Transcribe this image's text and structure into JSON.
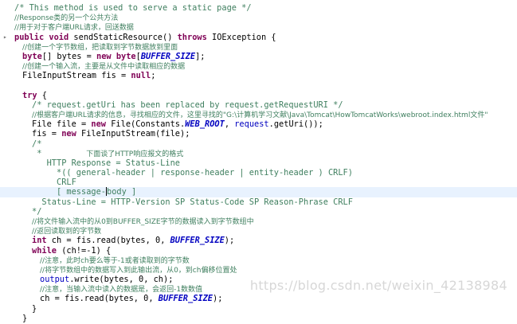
{
  "watermark": "https://blog.csdn.net/weixin_42138984",
  "lines": [
    {
      "indent": 18,
      "segs": [
        {
          "t": "/* This method is used to serve a static page */",
          "c": "cm"
        }
      ]
    },
    {
      "indent": 18,
      "segs": [
        {
          "t": "//Response类的另一个公共方法",
          "c": "cmzh"
        }
      ]
    },
    {
      "indent": 18,
      "segs": [
        {
          "t": "//用于对于客户端URL请求，回送数据",
          "c": "cmzh"
        }
      ]
    },
    {
      "indent": 18,
      "mark": true,
      "segs": [
        {
          "t": "public",
          "c": "kw"
        },
        {
          "t": " "
        },
        {
          "t": "void",
          "c": "kw"
        },
        {
          "t": " sendStaticResource() "
        },
        {
          "t": "throws",
          "c": "kw"
        },
        {
          "t": " IOException {"
        }
      ]
    },
    {
      "indent": 28,
      "segs": [
        {
          "t": "//创建一个字节数组，把读取到字节数据放到里面",
          "c": "cmzh"
        }
      ]
    },
    {
      "indent": 28,
      "segs": [
        {
          "t": "byte",
          "c": "kw"
        },
        {
          "t": "[] bytes = "
        },
        {
          "t": "new",
          "c": "kw"
        },
        {
          "t": " "
        },
        {
          "t": "byte",
          "c": "kw"
        },
        {
          "t": "["
        },
        {
          "t": "BUFFER_SIZE",
          "c": "fld"
        },
        {
          "t": "];"
        }
      ]
    },
    {
      "indent": 28,
      "segs": [
        {
          "t": "//创建一个输入流，主要是从文件中读取相应的数据",
          "c": "cmzh"
        }
      ]
    },
    {
      "indent": 28,
      "segs": [
        {
          "t": "FileInputStream fis = "
        },
        {
          "t": "null",
          "c": "kw"
        },
        {
          "t": ";"
        }
      ]
    },
    {
      "indent": 28,
      "segs": []
    },
    {
      "indent": 28,
      "segs": [
        {
          "t": "try",
          "c": "kw"
        },
        {
          "t": " {"
        }
      ]
    },
    {
      "indent": 40,
      "segs": [
        {
          "t": "/* request.getUri has been replaced by request.getRequestURI */",
          "c": "cm"
        }
      ]
    },
    {
      "indent": 40,
      "segs": [
        {
          "t": "//根据客户端URL请求的信息，寻找相应的文件，这里寻找的\"G:\\计算机学习文献\\Java\\Tomcat\\HowTomcatWorks\\webroot.index.html文件\"",
          "c": "cmzh"
        }
      ]
    },
    {
      "indent": 40,
      "segs": [
        {
          "t": "File file = "
        },
        {
          "t": "new",
          "c": "kw"
        },
        {
          "t": " File(Constants."
        },
        {
          "t": "WEB_ROOT",
          "c": "fld"
        },
        {
          "t": ", "
        },
        {
          "t": "request",
          "c": "fld2"
        },
        {
          "t": ".getUri());"
        }
      ]
    },
    {
      "indent": 40,
      "segs": [
        {
          "t": "fis = "
        },
        {
          "t": "new",
          "c": "kw"
        },
        {
          "t": " FileInputStream(file);"
        }
      ]
    },
    {
      "indent": 40,
      "segs": [
        {
          "t": "/*",
          "c": "cm"
        }
      ]
    },
    {
      "indent": 40,
      "segs": [
        {
          "t": " *         ",
          "c": "cm"
        },
        {
          "t": "下面谈了HTTP响应报文的格式",
          "c": "cmzh"
        }
      ]
    },
    {
      "indent": 40,
      "segs": [
        {
          "t": "   HTTP Response = Status-Line",
          "c": "cm"
        }
      ]
    },
    {
      "indent": 40,
      "segs": [
        {
          "t": "     *(( general-header | response-header | entity-header ) CRLF)",
          "c": "cm"
        }
      ]
    },
    {
      "indent": 40,
      "segs": [
        {
          "t": "     CRLF",
          "c": "cm"
        }
      ]
    },
    {
      "indent": 40,
      "hl": true,
      "cursorAt": 13,
      "segs": [
        {
          "t": "     [ message-",
          "c": "cm"
        },
        {
          "t": "CURSOR",
          "c": "cursor"
        },
        {
          "t": "body ]",
          "c": "cm"
        }
      ]
    },
    {
      "indent": 40,
      "segs": [
        {
          "t": "  Status-Line = HTTP-Version SP Status-Code SP Reason-Phrase CRLF",
          "c": "cm"
        }
      ]
    },
    {
      "indent": 40,
      "segs": [
        {
          "t": "*/",
          "c": "cm"
        }
      ]
    },
    {
      "indent": 40,
      "segs": [
        {
          "t": "//将文件输入流中的从0到BUFFER_SIZE字节的数据读入到字节数组中",
          "c": "cmzh"
        }
      ]
    },
    {
      "indent": 40,
      "segs": [
        {
          "t": "//返回读取到的字节数",
          "c": "cmzh"
        }
      ]
    },
    {
      "indent": 40,
      "segs": [
        {
          "t": "int",
          "c": "kw"
        },
        {
          "t": " ch = fis.read(bytes, 0, "
        },
        {
          "t": "BUFFER_SIZE",
          "c": "fld"
        },
        {
          "t": ");"
        }
      ]
    },
    {
      "indent": 40,
      "segs": [
        {
          "t": "while",
          "c": "kw"
        },
        {
          "t": " (ch!=-1) {"
        }
      ]
    },
    {
      "indent": 50,
      "segs": [
        {
          "t": "//注意，此时ch要么等于-1或者读取到的字节数",
          "c": "cmzh"
        }
      ]
    },
    {
      "indent": 50,
      "segs": [
        {
          "t": "//将字节数组中的数据写入到此输出流，从0，到ch偏移位置处",
          "c": "cmzh"
        }
      ]
    },
    {
      "indent": 50,
      "segs": [
        {
          "t": "output",
          "c": "fld2"
        },
        {
          "t": ".write(bytes, 0, ch);"
        }
      ]
    },
    {
      "indent": 50,
      "segs": [
        {
          "t": "//注意，当输入流中读入的数据是，会返回-1数数值",
          "c": "cmzh"
        }
      ]
    },
    {
      "indent": 50,
      "segs": [
        {
          "t": "ch = fis.read(bytes, 0, "
        },
        {
          "t": "BUFFER_SIZE",
          "c": "fld"
        },
        {
          "t": ");"
        }
      ]
    },
    {
      "indent": 40,
      "segs": [
        {
          "t": "}"
        }
      ]
    },
    {
      "indent": 28,
      "segs": [
        {
          "t": "}"
        }
      ]
    }
  ]
}
